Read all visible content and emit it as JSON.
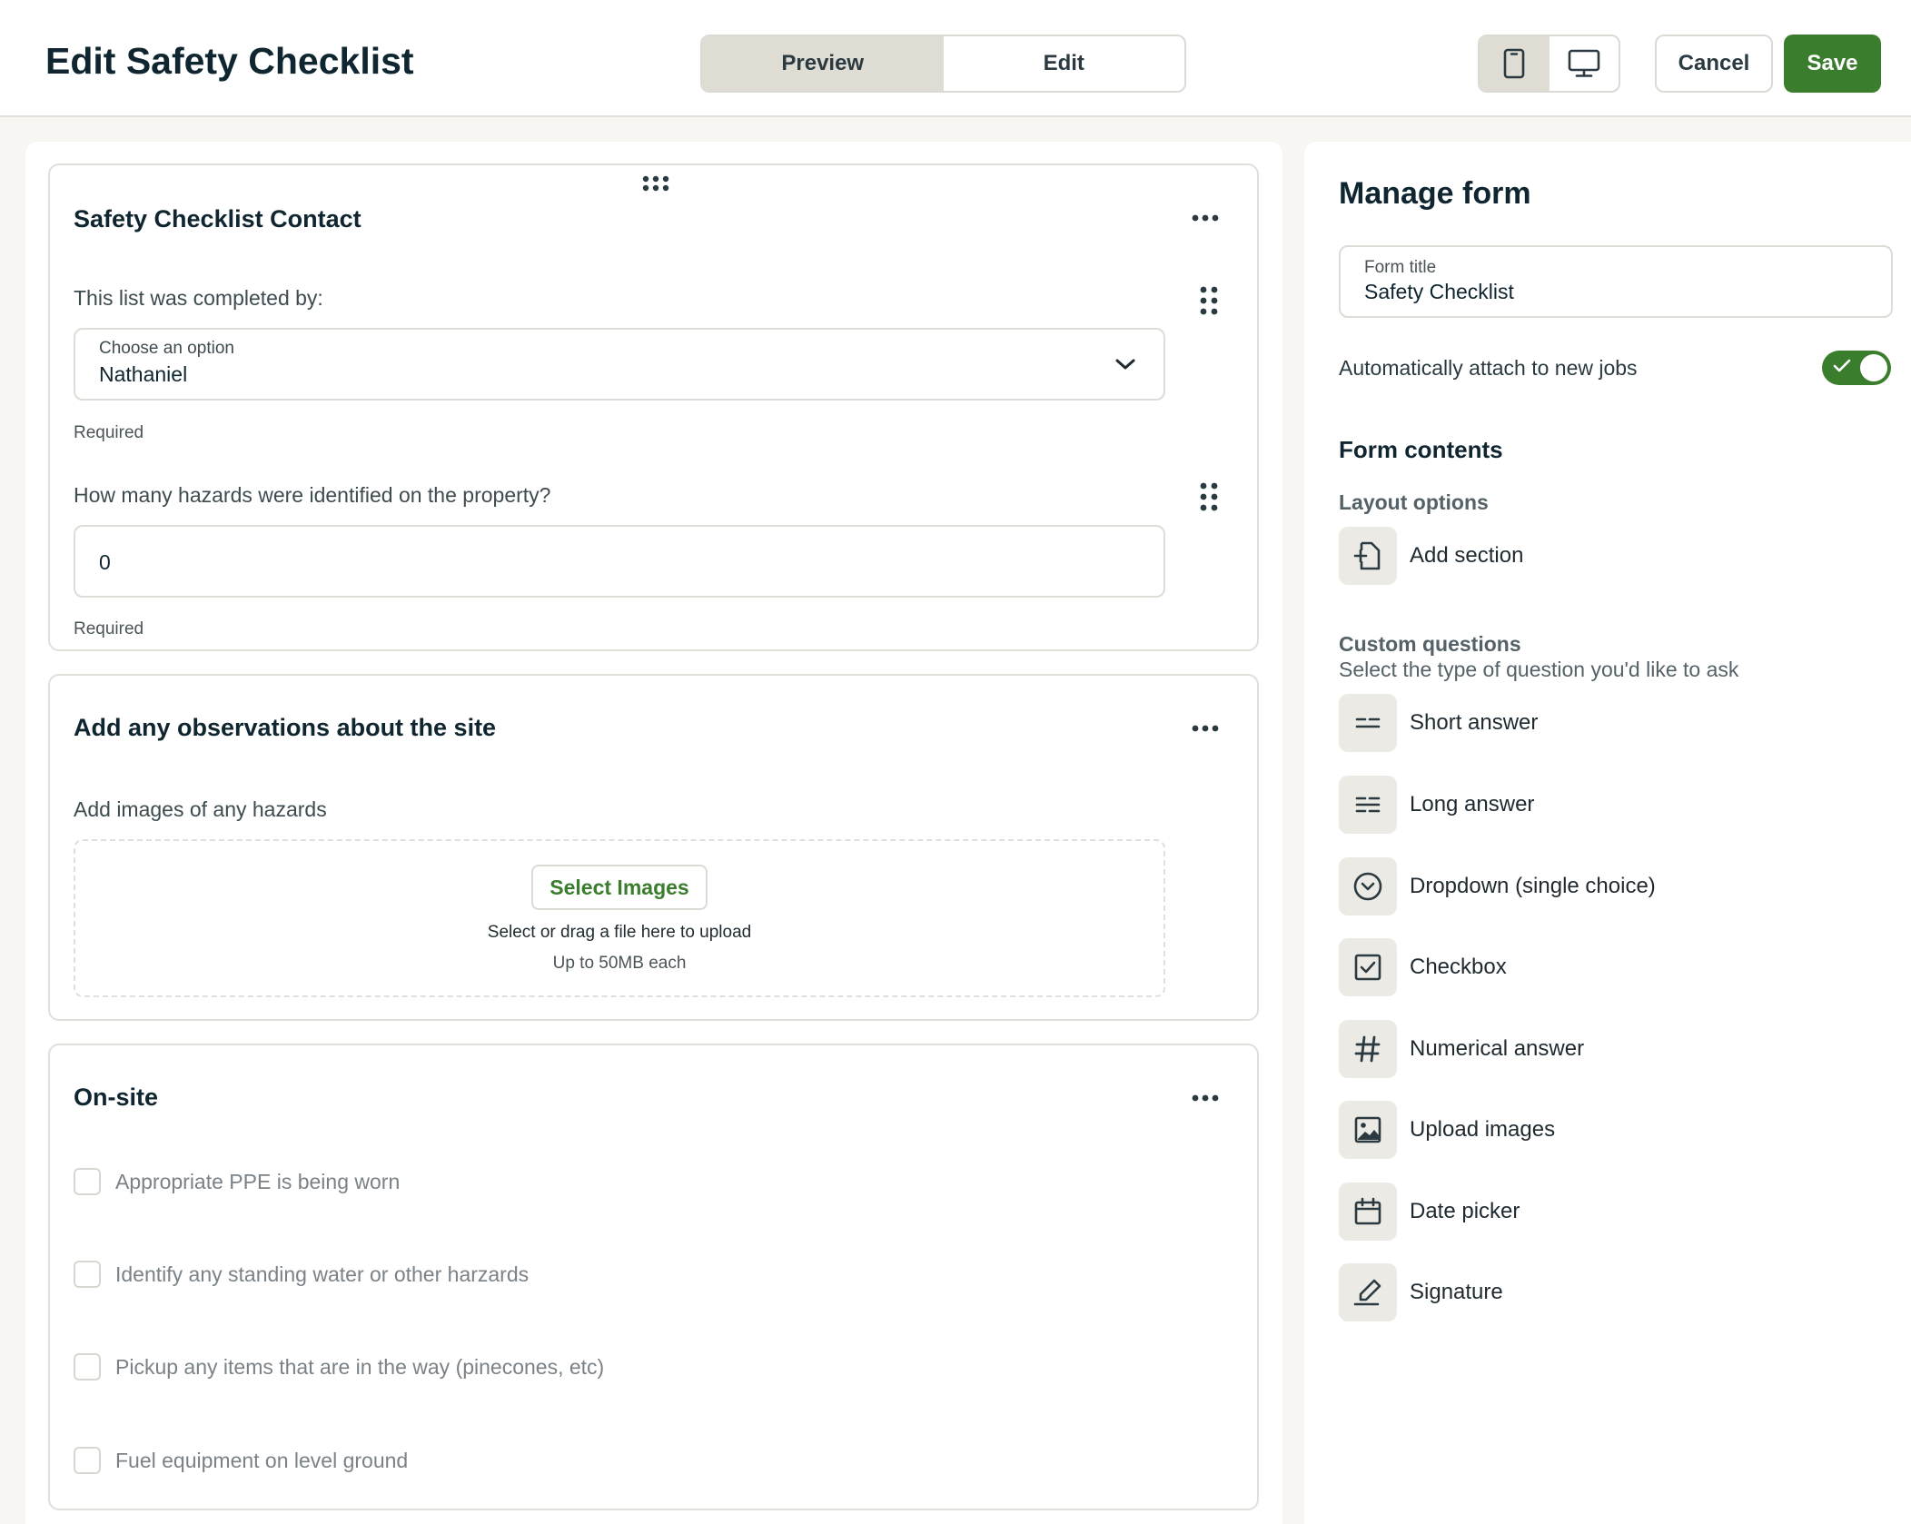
{
  "header": {
    "title": "Edit Safety Checklist",
    "tabs": [
      {
        "label": "Preview",
        "active": true
      },
      {
        "label": "Edit",
        "active": false
      }
    ],
    "device_modes": [
      {
        "icon": "mobile-device-icon",
        "active": true
      },
      {
        "icon": "desktop-monitor-icon",
        "active": false
      }
    ],
    "cancel_label": "Cancel",
    "save_label": "Save"
  },
  "sections": [
    {
      "title": "Safety Checklist Contact",
      "questions": [
        {
          "label": "This list was completed by:",
          "field_label": "Choose an option",
          "value": "Nathaniel",
          "hint": "Required"
        },
        {
          "label": "How many hazards were identified on the property?",
          "value": "0",
          "hint": "Required"
        }
      ]
    },
    {
      "title": "Add any observations about the site",
      "upload": {
        "label": "Add images of any hazards",
        "button": "Select Images",
        "line1": "Select or drag a file here to upload",
        "line2": "Up to 50MB each"
      }
    },
    {
      "title": "On-site",
      "checkboxes": [
        {
          "label": "Appropriate PPE is being worn",
          "checked": false
        },
        {
          "label": "Identify any standing water or other harzards",
          "checked": false
        },
        {
          "label": "Pickup any items that are in the way (pinecones, etc)",
          "checked": false
        },
        {
          "label": "Fuel equipment on level ground",
          "checked": false
        }
      ]
    }
  ],
  "panel": {
    "title": "Manage form",
    "form_title_label": "Form title",
    "form_title_value": "Safety Checklist",
    "attach_label": "Automatically attach to new jobs",
    "attach_enabled": true,
    "contents_heading": "Form contents",
    "layout_heading": "Layout options",
    "layout_items": [
      {
        "label": "Add section",
        "icon": "add-section-icon"
      }
    ],
    "custom_heading": "Custom questions",
    "custom_desc": "Select the type of question you'd like to ask",
    "custom_items": [
      {
        "label": "Short answer",
        "icon": "short-answer-icon"
      },
      {
        "label": "Long answer",
        "icon": "long-answer-icon"
      },
      {
        "label": "Dropdown (single choice)",
        "icon": "dropdown-icon"
      },
      {
        "label": "Checkbox",
        "icon": "checkbox-icon"
      },
      {
        "label": "Numerical answer",
        "icon": "hash-icon"
      },
      {
        "label": "Upload images",
        "icon": "image-icon"
      },
      {
        "label": "Date picker",
        "icon": "calendar-icon"
      },
      {
        "label": "Signature",
        "icon": "signature-icon"
      }
    ]
  },
  "colors": {
    "brand_green": "#3a7d2c",
    "active_segment": "#dedcd3",
    "border": "#dedcd6"
  }
}
